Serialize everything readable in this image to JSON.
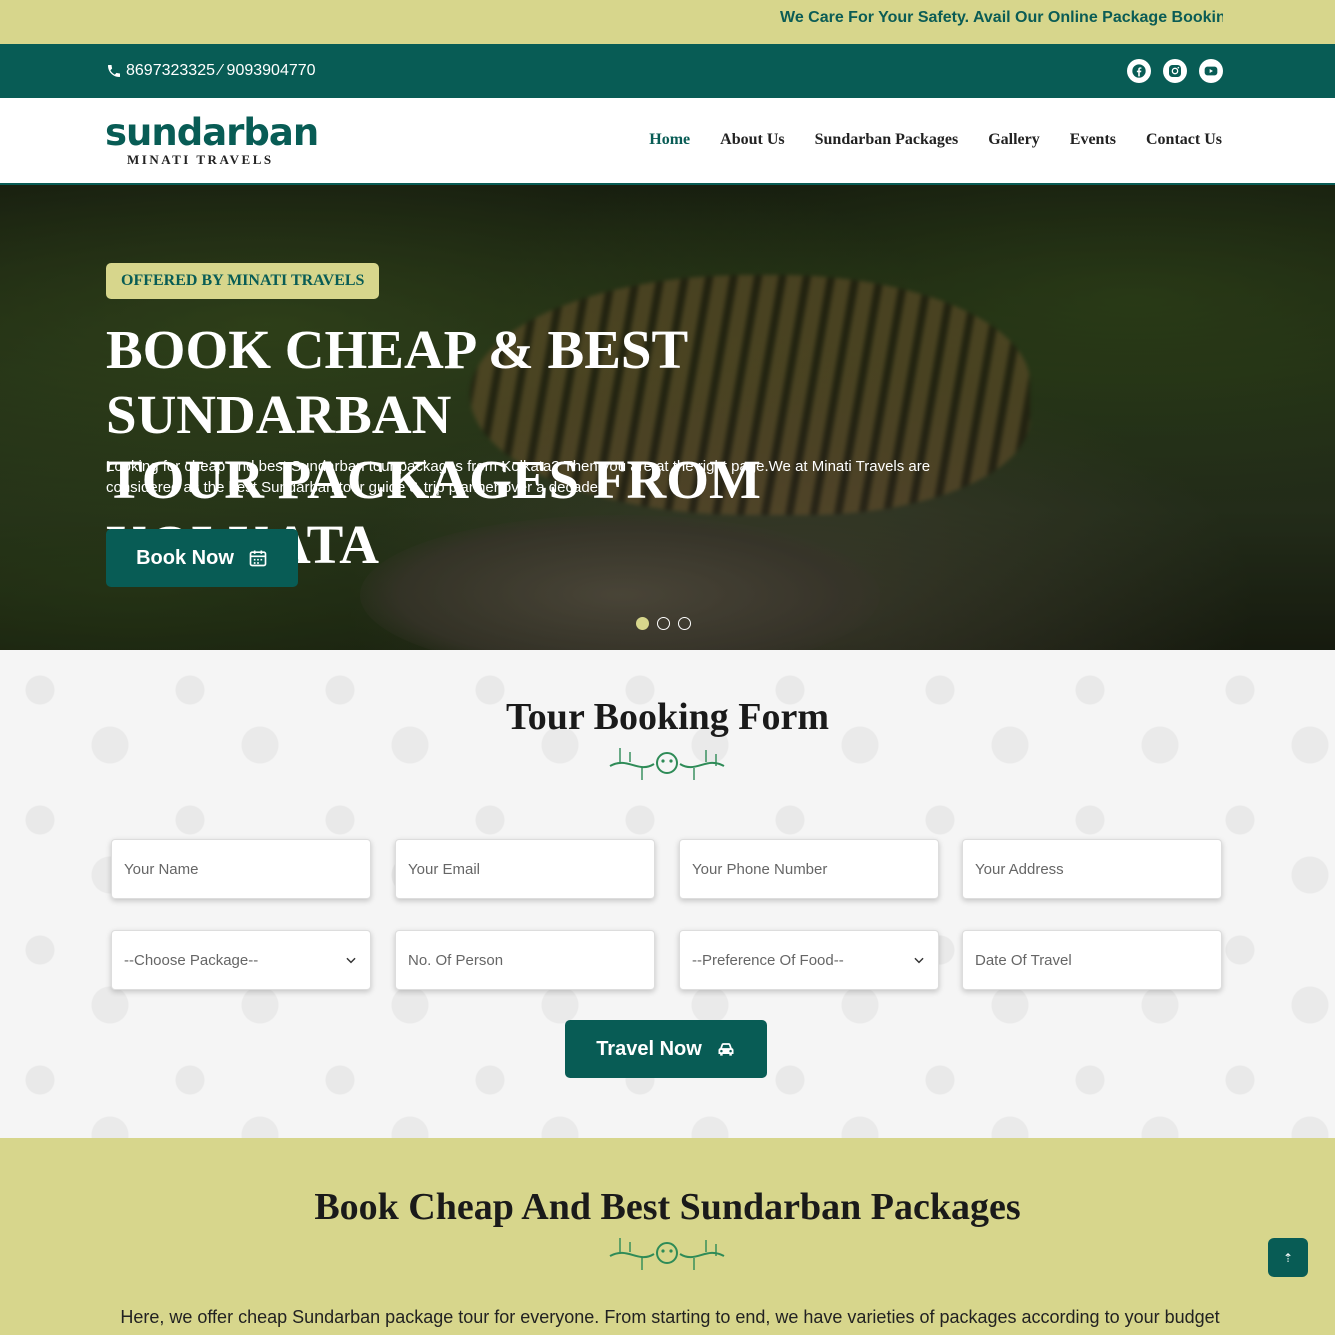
{
  "marquee": {
    "text": "We Care For Your Safety. Avail Our Online Package Booking C"
  },
  "topbar": {
    "phone": "8697323325 ⁄ 9093904770",
    "socials": [
      "facebook-icon",
      "instagram-icon",
      "youtube-icon"
    ]
  },
  "header": {
    "logo_word": "sundarban",
    "logo_sub": "MINATI TRAVELS",
    "nav": [
      "Home",
      "About Us",
      "Sundarban Packages",
      "Gallery",
      "Events",
      "Contact Us"
    ],
    "active": "Home"
  },
  "hero": {
    "badge": "OFFERED BY MINATI TRAVELS",
    "title_line1": "BOOK CHEAP & BEST SUNDARBAN",
    "title_line2": "TOUR PACKAGES FROM KOLKATA",
    "description": "Looking for cheap and best Sundarban tour packages from Kolkata? Then you are at the right page.We at Minati Travels are considered as the best Sundarban tour guide & trip planner over a decade.",
    "button": "Book Now",
    "slides": 3,
    "active_slide": 1
  },
  "booking": {
    "title": "Tour Booking Form",
    "fields": {
      "name": "Your Name",
      "email": "Your Email",
      "phone": "Your Phone Number",
      "address": "Your Address",
      "package": "--Choose Package--",
      "persons": "No. Of Person",
      "food": "--Preference Of Food--",
      "date": "Date Of Travel"
    },
    "submit": "Travel Now"
  },
  "packages": {
    "title": "Book Cheap And Best Sundarban Packages",
    "intro": "Here, we offer cheap Sundarban package tour for everyone. From starting to end, we have varieties of packages according to your budget and need. The facilities we provide to our guests are second to none. So if you are looking for cheap Sundarban package tour or going for"
  },
  "colors": {
    "brand": "#085c55",
    "accent": "#d7d68c"
  },
  "scroll_top_label": "⇡"
}
